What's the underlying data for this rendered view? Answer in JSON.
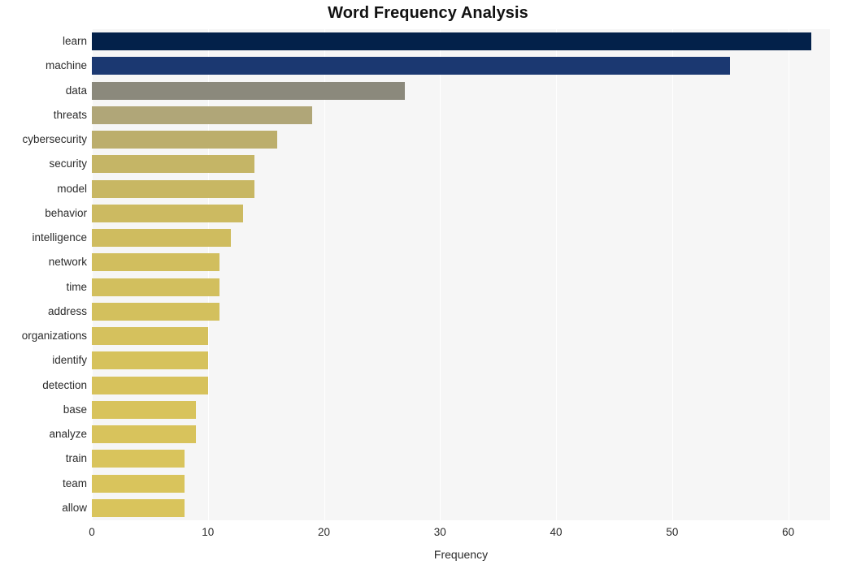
{
  "chart_data": {
    "type": "bar",
    "orientation": "horizontal",
    "title": "Word Frequency Analysis",
    "xlabel": "Frequency",
    "ylabel": "",
    "xlim": [
      0,
      63.6
    ],
    "xticks": [
      0,
      10,
      20,
      30,
      40,
      50,
      60
    ],
    "xticklabels": [
      "0",
      "10",
      "20",
      "30",
      "40",
      "50",
      "60"
    ],
    "grid": "vertical-white-on-light-panel",
    "legend": "none",
    "categories": [
      "learn",
      "machine",
      "data",
      "threats",
      "cybersecurity",
      "security",
      "model",
      "behavior",
      "intelligence",
      "network",
      "time",
      "address",
      "organizations",
      "identify",
      "detection",
      "base",
      "analyze",
      "train",
      "team",
      "allow"
    ],
    "values": [
      62,
      55,
      27,
      19,
      16,
      14,
      14,
      13,
      12,
      11,
      11,
      11,
      10,
      10,
      10,
      9,
      9,
      8,
      8,
      8
    ],
    "bar_colors": [
      "#03214a",
      "#1b3871",
      "#8b897c",
      "#b0a678",
      "#bcae6c",
      "#c5b566",
      "#c8b763",
      "#ccba61",
      "#cfbc5f",
      "#d1be5e",
      "#d2bf5e",
      "#d3c05d",
      "#d5c15d",
      "#d6c25c",
      "#d7c25c",
      "#d8c35c",
      "#d8c35c",
      "#d9c45c",
      "#d9c45c",
      "#d9c45c"
    ],
    "plot_background": "#f6f6f6",
    "figure_background": "#ffffff",
    "title_color": "#111111",
    "tick_color": "#2b2b2b"
  }
}
